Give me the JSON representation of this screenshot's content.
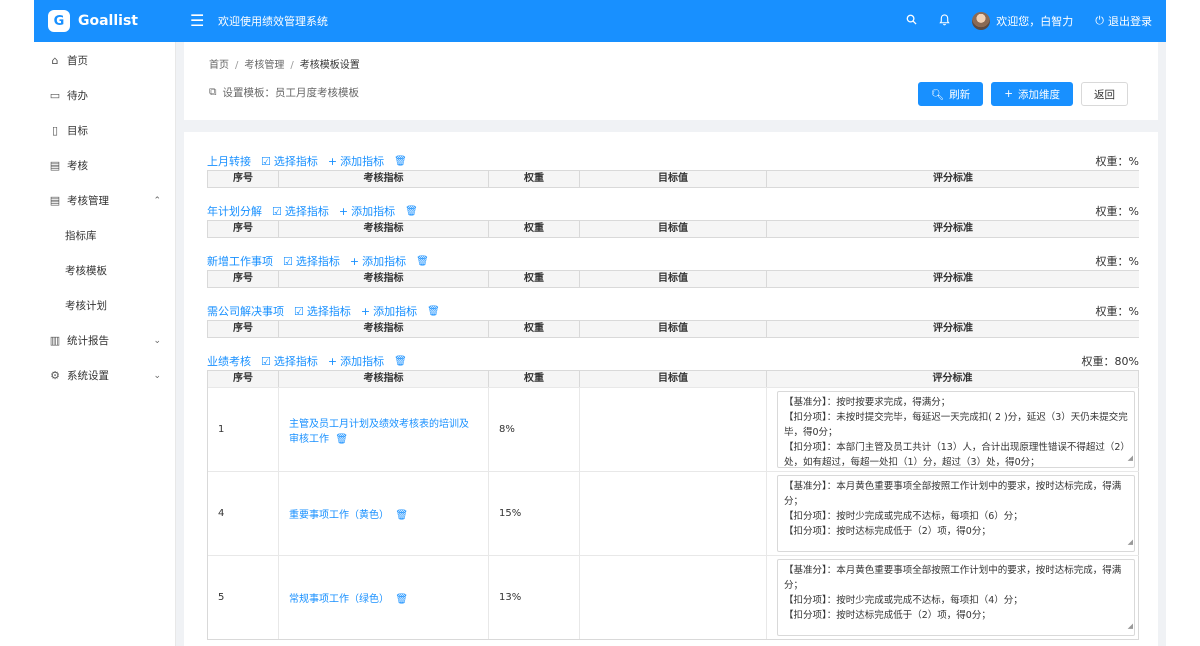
{
  "app": {
    "name": "Goallist",
    "logo_glyph": "G",
    "welcome": "欢迎使用绩效管理系统"
  },
  "topbar": {
    "user_greeting": "欢迎您，白智力",
    "logout_label": "退出登录",
    "search_icon": "search-icon",
    "bell_icon": "bell-icon"
  },
  "sidebar": {
    "items": [
      {
        "label": "首页",
        "icon": "⌂"
      },
      {
        "label": "待办",
        "icon": "▭"
      },
      {
        "label": "目标",
        "icon": "▯"
      },
      {
        "label": "考核",
        "icon": "▤"
      },
      {
        "label": "考核管理",
        "icon": "▤",
        "caret": "⌃"
      },
      {
        "label": "指标库"
      },
      {
        "label": "考核模板"
      },
      {
        "label": "考核计划"
      },
      {
        "label": "统计报告",
        "icon": "▥",
        "caret": "⌄"
      },
      {
        "label": "系统设置",
        "icon": "⚙",
        "caret": "⌄"
      }
    ]
  },
  "breadcrumb": {
    "home": "首页",
    "mgmt": "考核管理",
    "current": "考核模板设置",
    "sep": "/"
  },
  "template": {
    "text": "设置模板：员工月度考核模板"
  },
  "buttons": {
    "refresh": "刷新",
    "add_dimension": "添加维度",
    "back": "返回"
  },
  "common": {
    "select_indicator": "选择指标",
    "add_indicator": "添加指标"
  },
  "columns": [
    "序号",
    "考核指标",
    "权重",
    "目标值",
    "评分标准"
  ],
  "sections": [
    {
      "title": "上月转接",
      "weight": "权重：%"
    },
    {
      "title": "年计划分解",
      "weight": "权重：%"
    },
    {
      "title": "新增工作事项",
      "weight": "权重：%"
    },
    {
      "title": "需公司解决事项",
      "weight": "权重：%"
    },
    {
      "title": "业绩考核",
      "weight": "权重：80%"
    }
  ],
  "rows": [
    {
      "no": "1",
      "indicator": "主管及员工月计划及绩效考核表的培训及审核工作",
      "weight": "8%",
      "target": "",
      "std": [
        "【基准分】：按时按要求完成，得满分；",
        "【扣分项】：未按时提交完毕，每延迟一天完成扣( 2 )分，延迟（3）天仍未提交完毕，得0分；",
        "【扣分项】：本部门主管及员工共计（13）人，合计出现原理性错误不得超过（2）处，如有超过，每超一处扣（1）分，超过（3）处，得0分；"
      ]
    },
    {
      "no": "4",
      "indicator": "重要事项工作（黄色）",
      "weight": "15%",
      "target": "",
      "std": [
        "【基准分】：本月黄色重要事项全部按照工作计划中的要求，按时达标完成，得满分；",
        "【扣分项】：按时少完成或完成不达标，每项扣（6）分；",
        "【扣分项】：按时达标完成低于（2）项，得0分；"
      ]
    },
    {
      "no": "5",
      "indicator": "常规事项工作（绿色）",
      "weight": "13%",
      "target": "",
      "std": [
        "【基准分】：本月黄色重要事项全部按照工作计划中的要求，按时达标完成，得满分；",
        "【扣分项】：按时少完成或完成不达标，每项扣（4）分；",
        "【扣分项】：按时达标完成低于（2）项，得0分；"
      ]
    }
  ]
}
